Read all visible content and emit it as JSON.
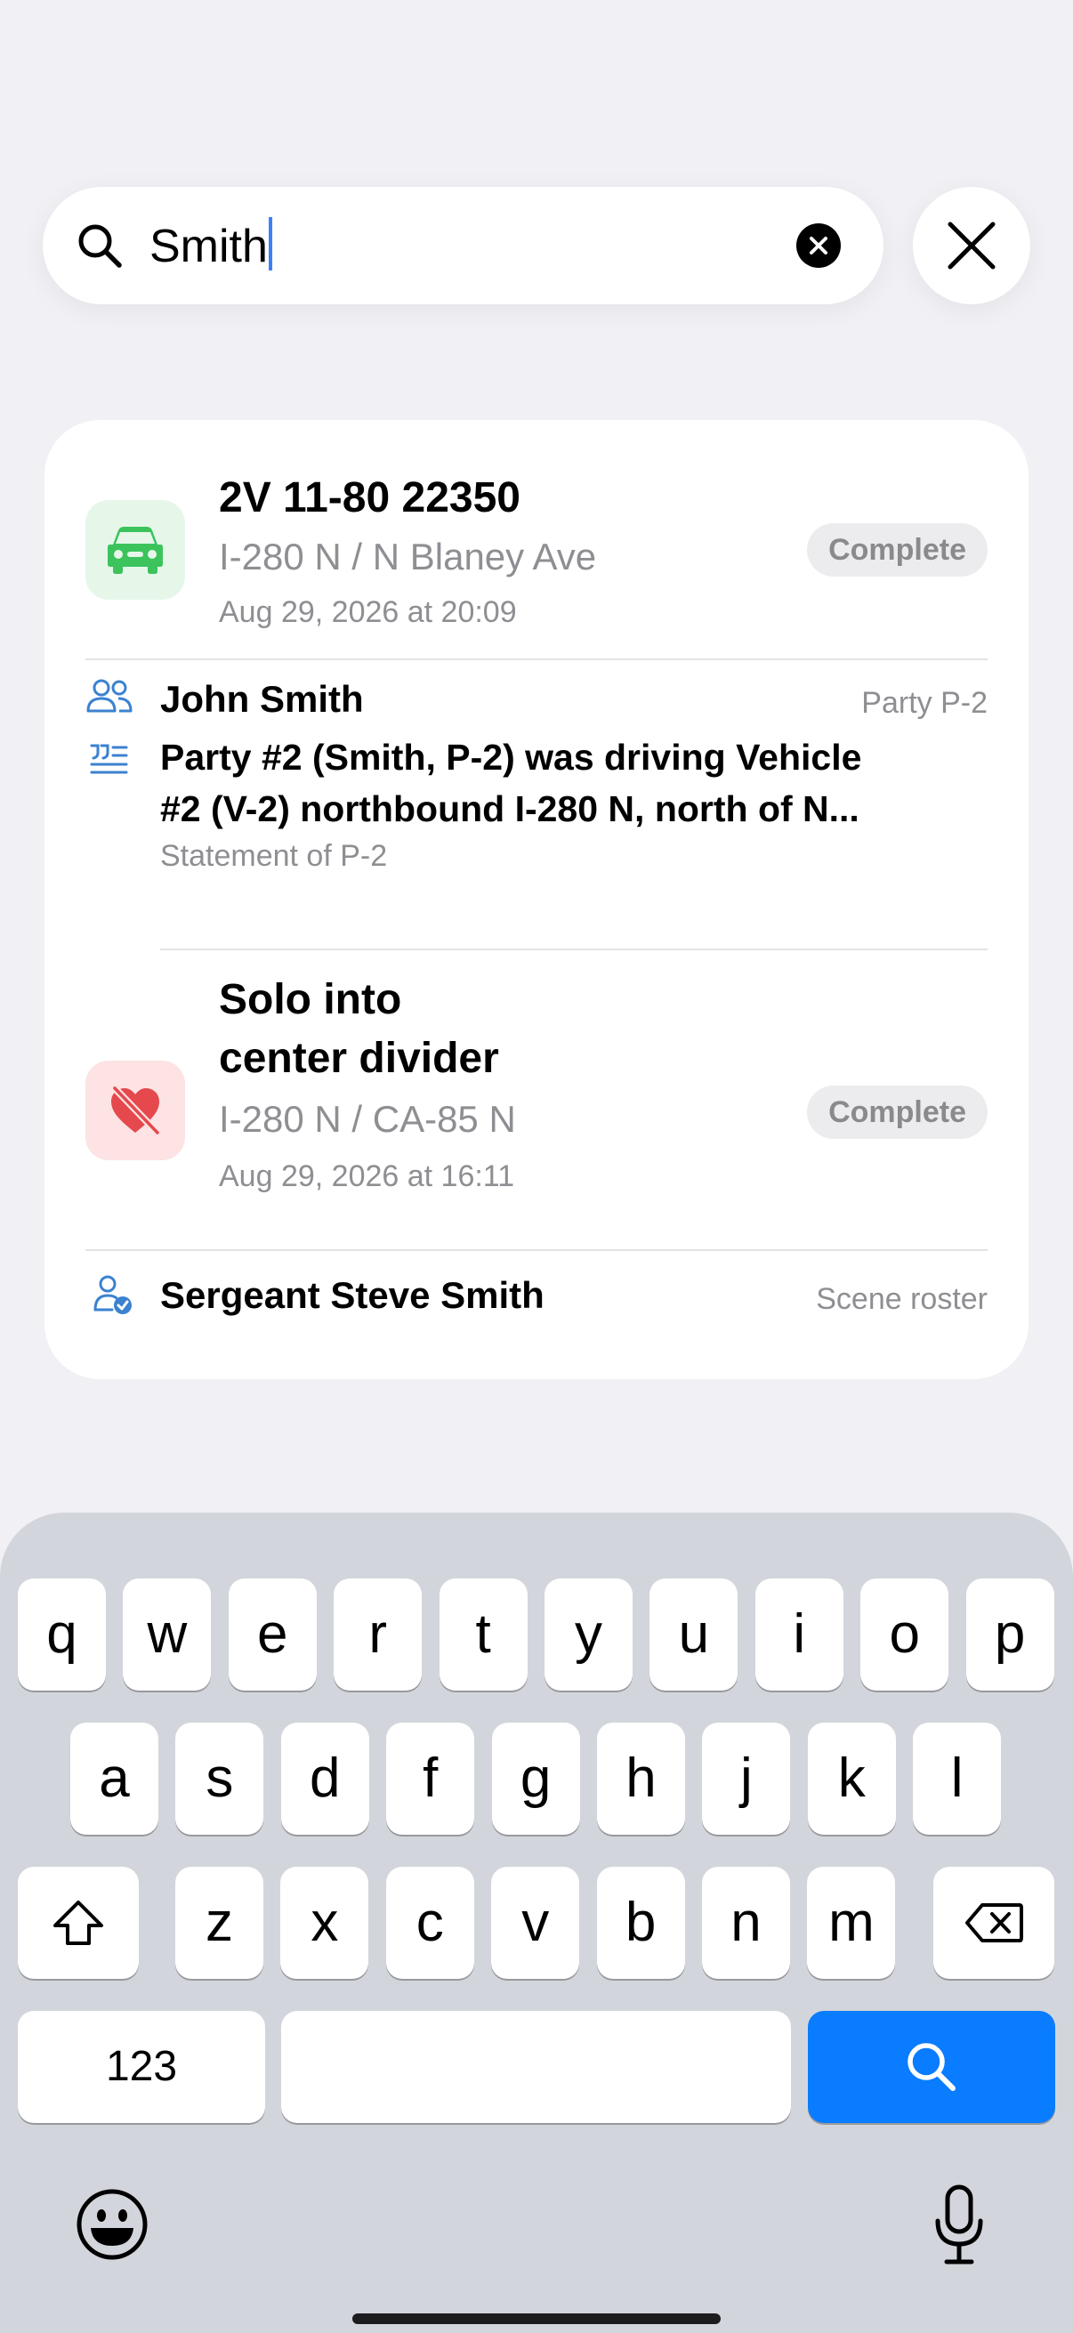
{
  "search": {
    "query": "Smith"
  },
  "results": [
    {
      "title": "2V 11-80 22350",
      "location": "I-280 N / N Blaney Ave",
      "datetime": "Aug 29, 2026 at 20:09",
      "status": "Complete",
      "icon": "car-icon",
      "tile_color": "#e6f7ea",
      "icon_color": "#3cc35c",
      "matches": [
        {
          "type": "party",
          "name": "John Smith",
          "meta": "Party P-2",
          "icon": "people-icon"
        },
        {
          "type": "statement",
          "text_line1": "Party #2 (Smith, P-2) was driving Vehicle",
          "text_line2": "#2 (V-2) northbound I-280 N, north of N...",
          "caption": "Statement of P-2",
          "icon": "quote-icon"
        }
      ]
    },
    {
      "title_line1": "Solo into",
      "title_line2": "center divider",
      "location": "I-280 N / CA-85 N",
      "datetime": "Aug 29, 2026 at 16:11",
      "status": "Complete",
      "icon": "heart-slash-icon",
      "tile_color": "#fde3e3",
      "icon_color": "#e5484d",
      "matches": [
        {
          "type": "roster",
          "name": "Sergeant Steve Smith",
          "meta": "Scene roster",
          "icon": "person-check-icon"
        }
      ]
    }
  ],
  "keyboard": {
    "row1": [
      "q",
      "w",
      "e",
      "r",
      "t",
      "y",
      "u",
      "i",
      "o",
      "p"
    ],
    "row2": [
      "a",
      "s",
      "d",
      "f",
      "g",
      "h",
      "j",
      "k",
      "l"
    ],
    "row3": [
      "z",
      "x",
      "c",
      "v",
      "b",
      "n",
      "m"
    ],
    "numbers_label": "123",
    "accent_color": "#0a7cff"
  }
}
